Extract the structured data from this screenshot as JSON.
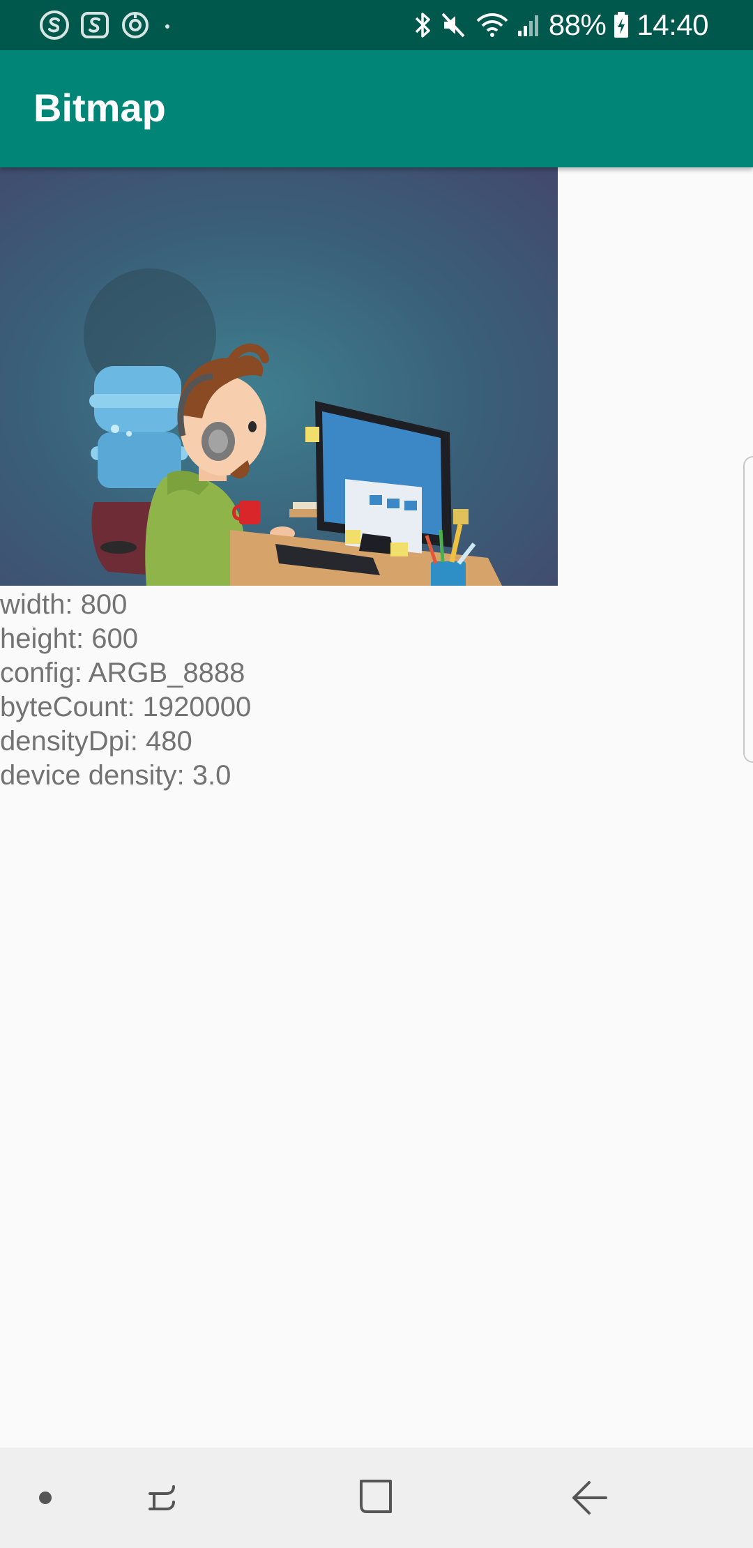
{
  "status_bar": {
    "icons_left": [
      "skype-icon",
      "swiftkey-icon",
      "sync-icon",
      "notification-dot-icon"
    ],
    "icons_right": [
      "bluetooth-icon",
      "mute-icon",
      "wifi-icon",
      "signal-icon",
      "battery-charging-icon"
    ],
    "battery": "88%",
    "time": "14:40",
    "background_color": "#00574b"
  },
  "app_bar": {
    "title": "Bitmap",
    "background_color": "#008577"
  },
  "image": {
    "description_icon": "developer-at-computer-illustration"
  },
  "info": {
    "width": "width: 800",
    "height": "height: 600",
    "config": "config: ARGB_8888",
    "byte_count": "byteCount: 1920000",
    "density_dpi": "densityDpi: 480",
    "device_density": "device density: 3.0"
  },
  "nav_bar": {
    "items": [
      "dot-icon",
      "recents-icon",
      "home-icon",
      "back-icon"
    ]
  }
}
